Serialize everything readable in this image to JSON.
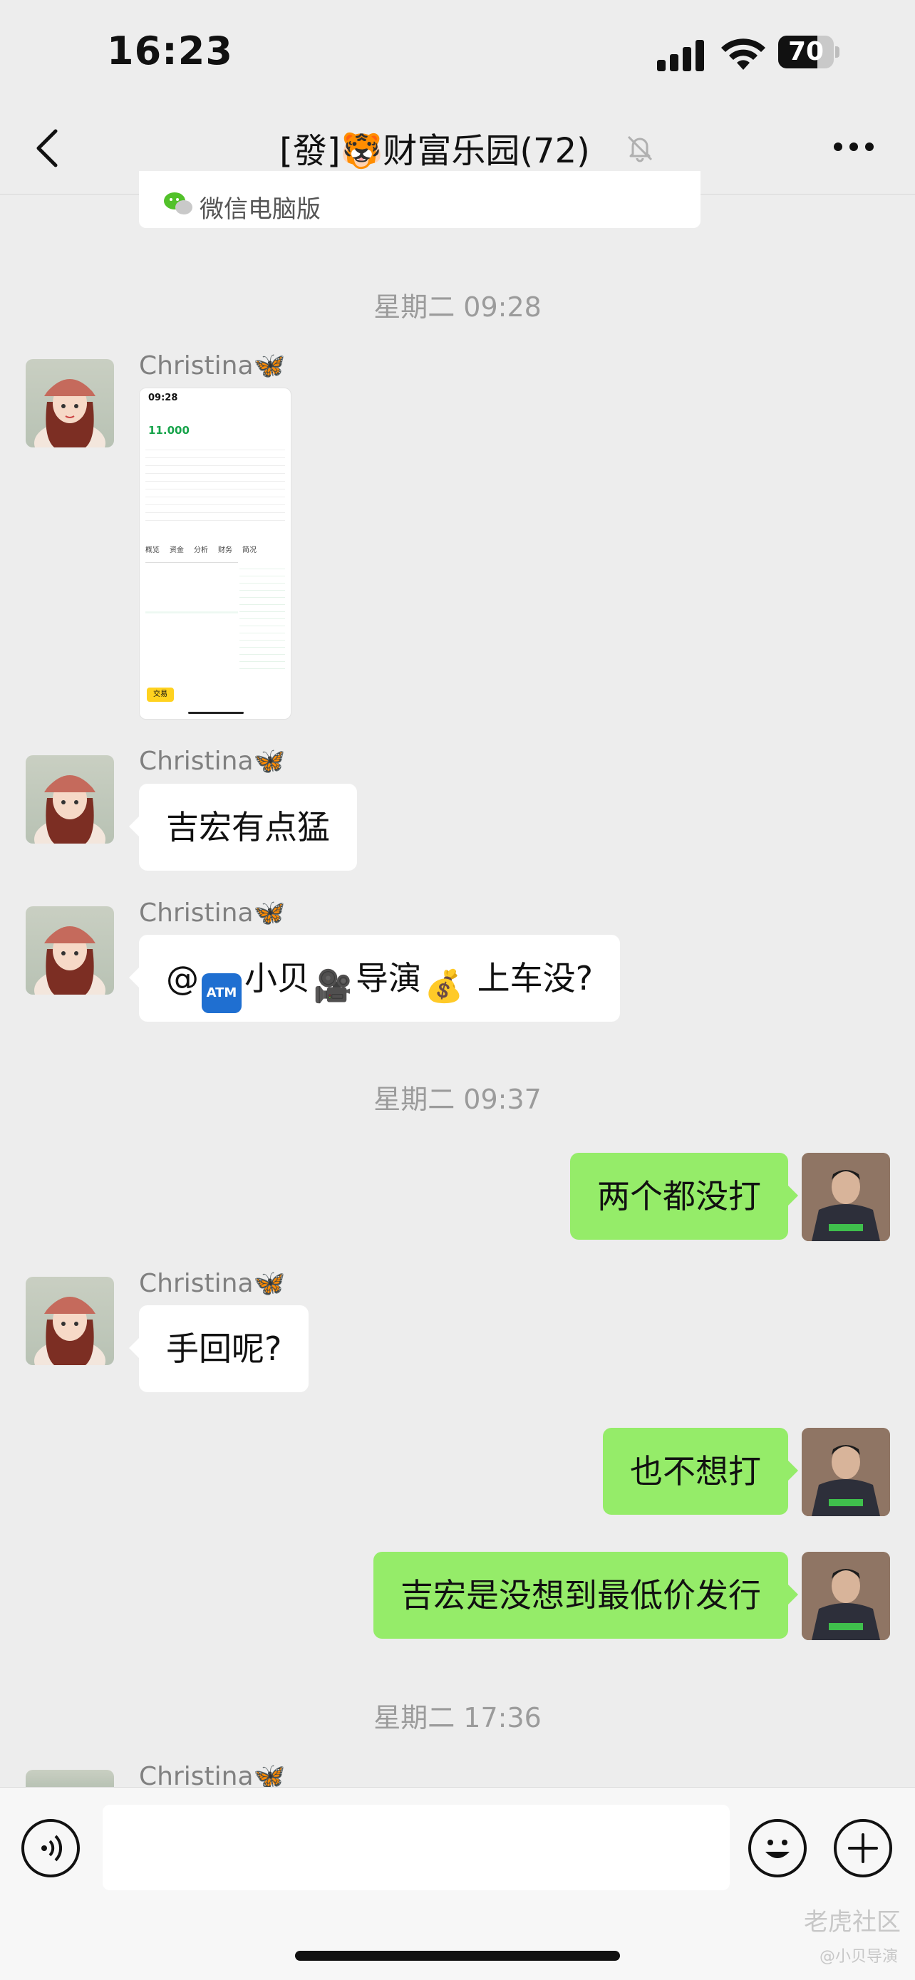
{
  "status_bar": {
    "time": "16:23",
    "battery": "70",
    "battery_level": 0.7
  },
  "header": {
    "title": "[發]🐯财富乐园(72)"
  },
  "top_card": {
    "label": "微信电脑版"
  },
  "timestamps": [
    "星期二 09:28",
    "星期二 09:37",
    "星期二 17:36"
  ],
  "sender": {
    "name": "Christina",
    "badge": "🦋"
  },
  "screenshot_thumb": {
    "time": "09:28",
    "price": "11.000",
    "tabs": [
      "概览",
      "资金",
      "分析",
      "财务",
      "简况"
    ],
    "trade_button": "交易"
  },
  "messages": {
    "m1": "吉宏有点猛",
    "m2_prefix": "@",
    "m2_name_a": "小贝",
    "m2_name_b": "导演",
    "m2_suffix": " 上车没?",
    "m3": "两个都没打",
    "m4": "手回呢?",
    "m5": "也不想打",
    "m6": "吉宏是没想到最低价发行"
  },
  "emoji": {
    "atm": "ATM",
    "camera": "🎥",
    "moneybag": "💰"
  },
  "watermark": {
    "main": "老虎社区",
    "sub": "@小贝导演"
  },
  "colors": {
    "background": "#ededed",
    "incoming": "#ffffff",
    "outgoing": "#95ec69"
  }
}
